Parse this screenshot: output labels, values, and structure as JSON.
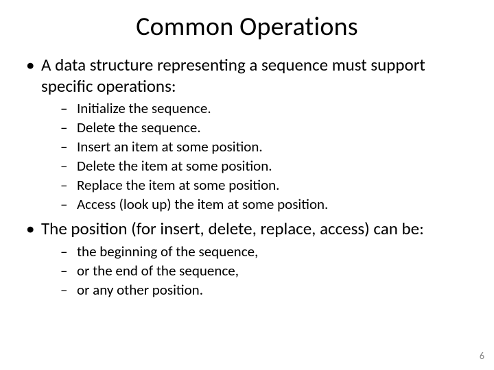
{
  "title": "Common Operations",
  "bullets": [
    {
      "text": "A data structure representing a sequence must support specific operations:",
      "sub": [
        "Initialize the sequence.",
        "Delete the sequence.",
        "Insert an item at some position.",
        "Delete the item at some position.",
        "Replace the item at some position.",
        "Access (look up) the item at some position."
      ]
    },
    {
      "text": "The position (for insert, delete, replace, access) can be:",
      "sub": [
        "the beginning of the sequence,",
        "or the end of the sequence,",
        "or any other position."
      ]
    }
  ],
  "page_number": "6"
}
